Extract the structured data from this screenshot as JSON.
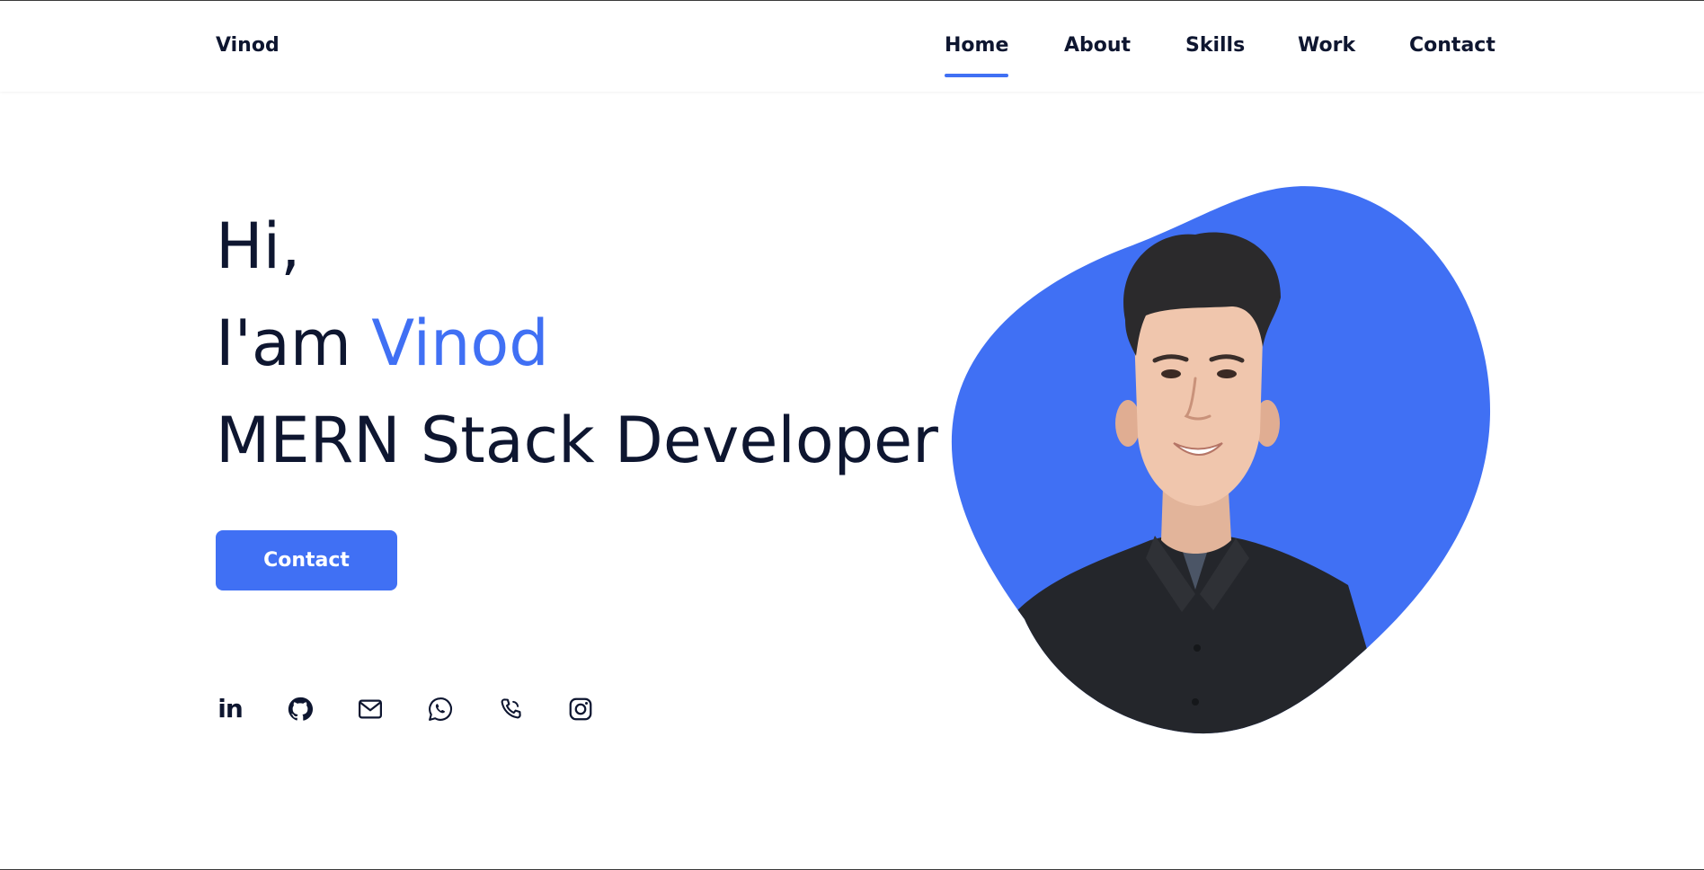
{
  "header": {
    "logo": "Vinod",
    "nav": [
      {
        "label": "Home",
        "active": true
      },
      {
        "label": "About",
        "active": false
      },
      {
        "label": "Skills",
        "active": false
      },
      {
        "label": "Work",
        "active": false
      },
      {
        "label": "Contact",
        "active": false
      }
    ]
  },
  "hero": {
    "greeting": "Hi,",
    "intro_prefix": "I'am ",
    "name": "Vinod",
    "role": "MERN Stack Developer",
    "cta_label": "Contact"
  },
  "socials": [
    {
      "icon": "linkedin-icon"
    },
    {
      "icon": "github-icon"
    },
    {
      "icon": "mail-icon"
    },
    {
      "icon": "whatsapp-icon"
    },
    {
      "icon": "phone-icon"
    },
    {
      "icon": "instagram-icon"
    }
  ],
  "colors": {
    "accent": "#4070f4",
    "text": "#0e1630",
    "background": "#ffffff"
  }
}
